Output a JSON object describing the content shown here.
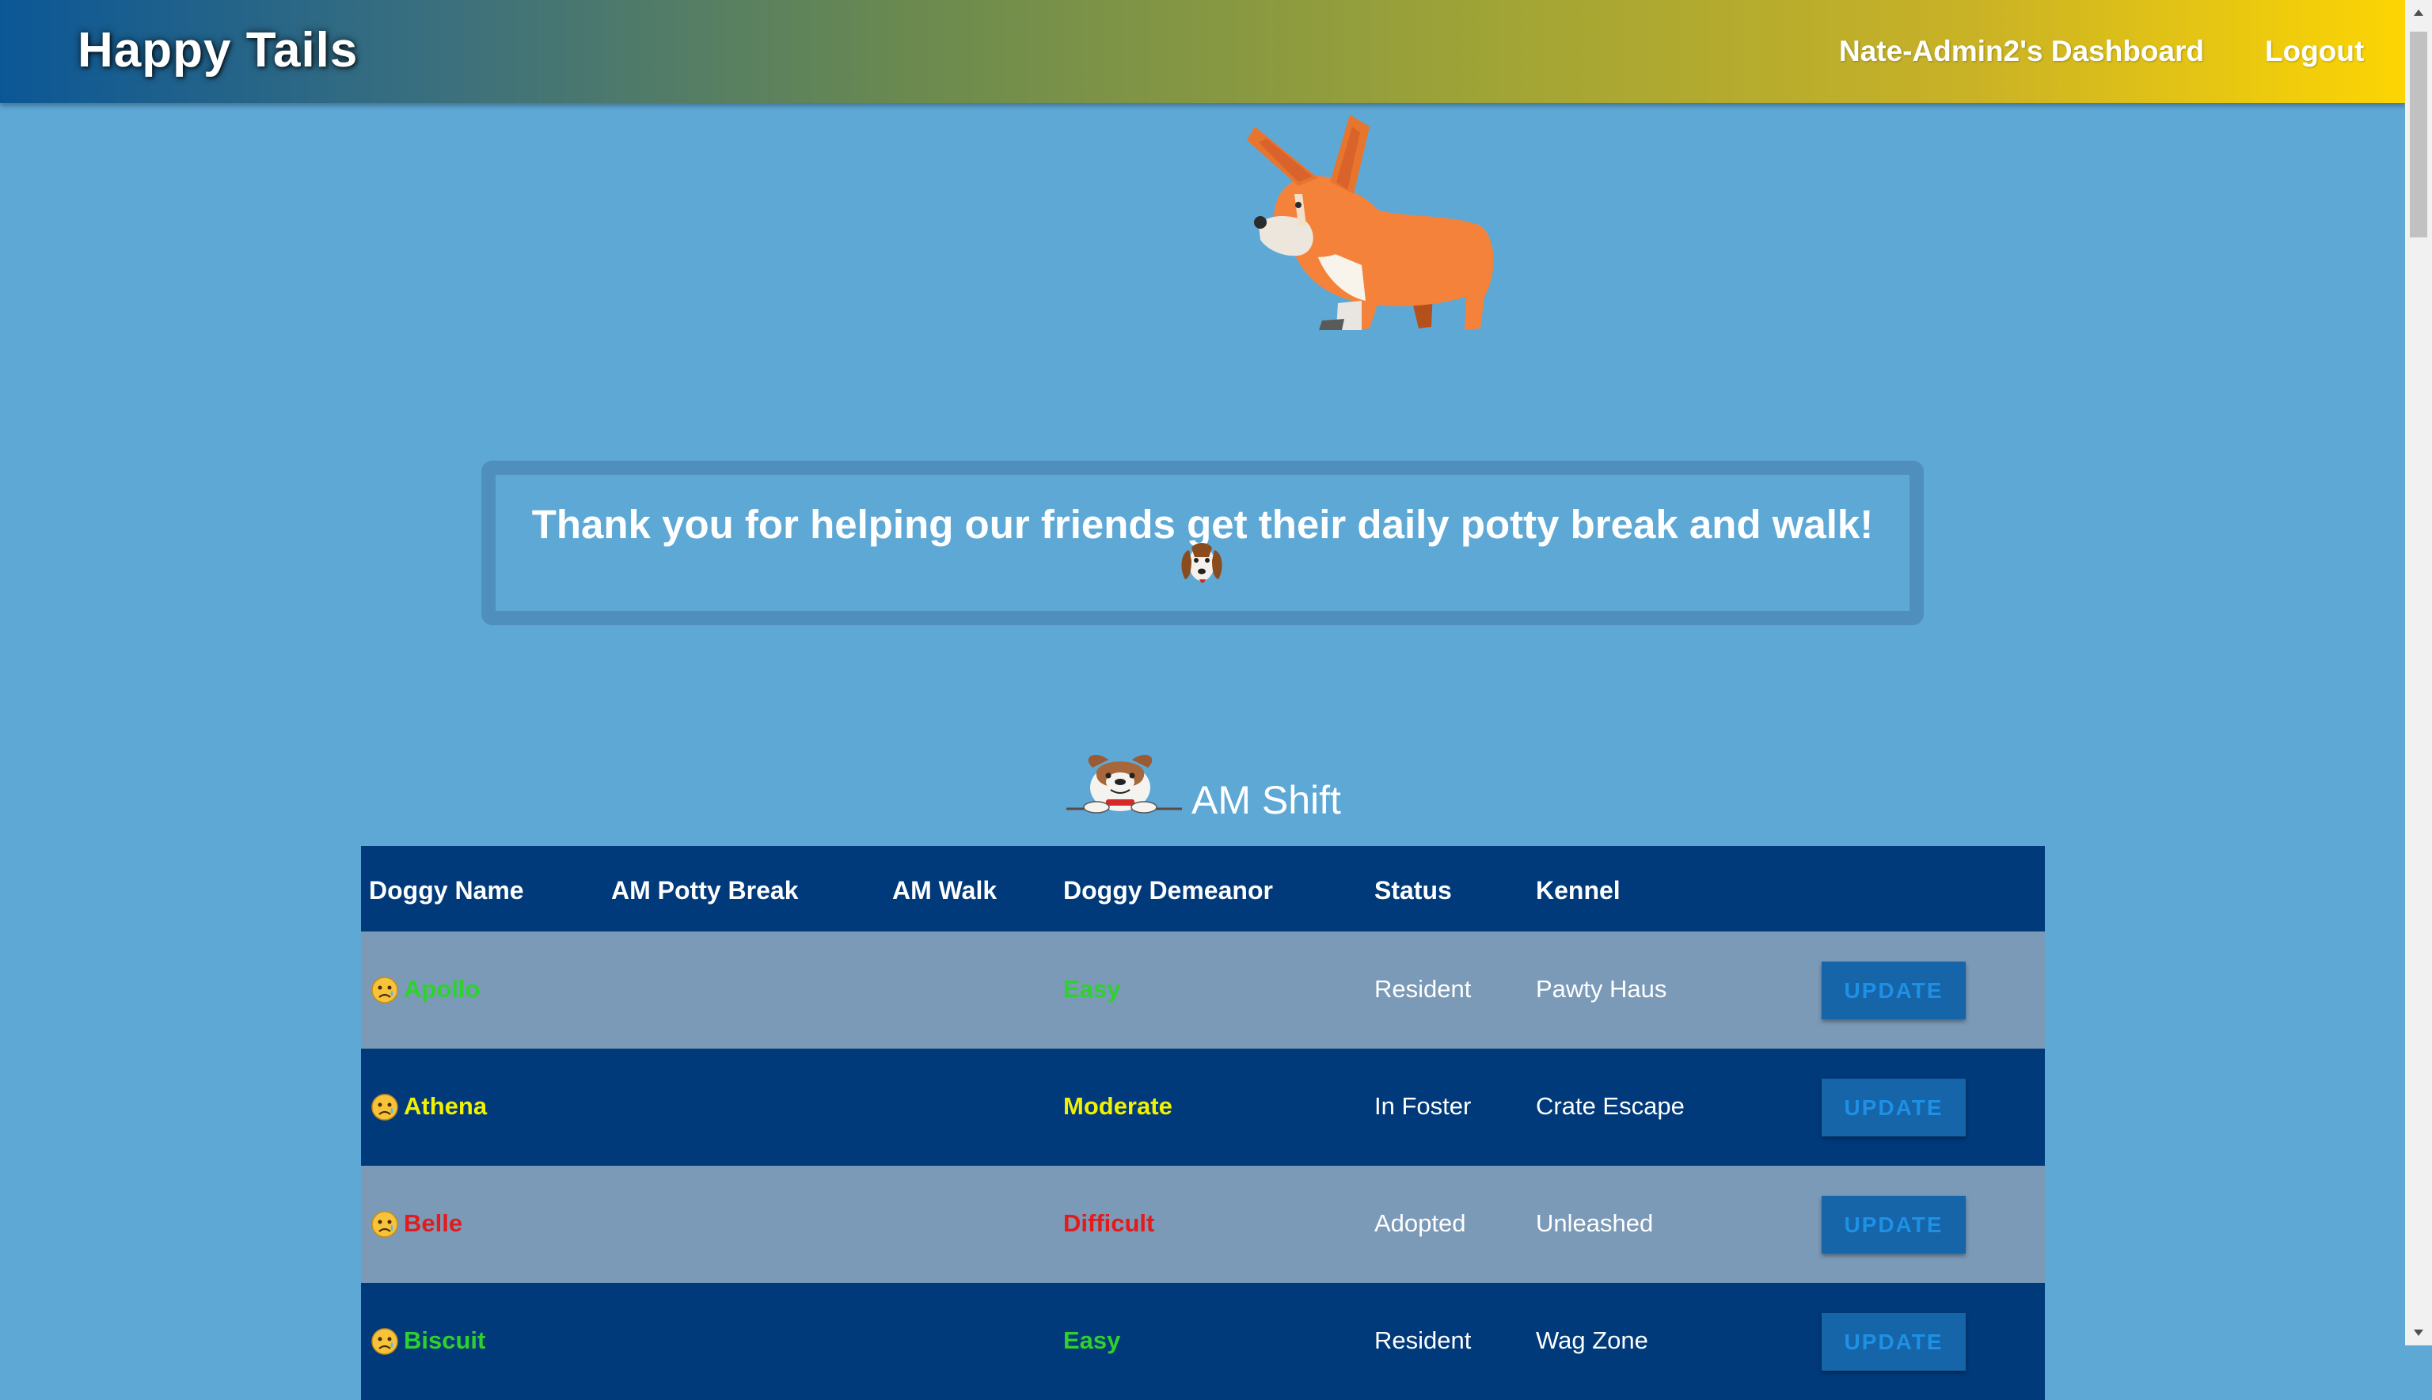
{
  "navbar": {
    "brand": "Happy Tails",
    "dashboard_link": "Nate-Admin2's Dashboard",
    "logout_link": "Logout"
  },
  "message": {
    "text": "Thank you for helping our friends get their daily potty break and walk!"
  },
  "shift": {
    "title": "AM Shift"
  },
  "table": {
    "headers": [
      "Doggy Name",
      "AM Potty Break",
      "AM Walk",
      "Doggy Demeanor",
      "Status",
      "Kennel"
    ],
    "button_label": "UPDATE",
    "rows": [
      {
        "name": "Apollo",
        "potty": "",
        "walk": "",
        "demeanor": "Easy",
        "status": "Resident",
        "kennel": "Pawty Haus",
        "color": "#2ed12e"
      },
      {
        "name": "Athena",
        "potty": "",
        "walk": "",
        "demeanor": "Moderate",
        "status": "In Foster",
        "kennel": "Crate Escape",
        "color": "#f2f200"
      },
      {
        "name": "Belle",
        "potty": "",
        "walk": "",
        "demeanor": "Difficult",
        "status": "Adopted",
        "kennel": "Unleashed",
        "color": "#e31b1b"
      },
      {
        "name": "Biscuit",
        "potty": "",
        "walk": "",
        "demeanor": "Easy",
        "status": "Resident",
        "kennel": "Wag Zone",
        "color": "#2ed12e"
      }
    ]
  },
  "colors": {
    "background": "#5ea8d6",
    "table_dark_row": "#003a7a",
    "table_light_row": "#7b9ab8",
    "easy": "#2ed12e",
    "moderate": "#f2f200",
    "difficult": "#e31b1b"
  }
}
